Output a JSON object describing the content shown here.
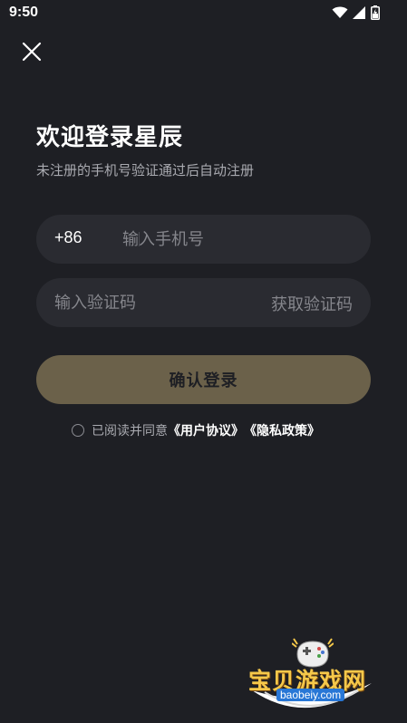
{
  "status_bar": {
    "time": "9:50"
  },
  "header": {
    "title": "欢迎登录星辰",
    "subtitle": "未注册的手机号验证通过后自动注册"
  },
  "phone_field": {
    "country_code": "+86",
    "placeholder": "输入手机号",
    "value": ""
  },
  "code_field": {
    "placeholder": "输入验证码",
    "value": "",
    "get_code_label": "获取验证码"
  },
  "login_button": {
    "label": "确认登录"
  },
  "agreement": {
    "checked": false,
    "prefix": "已阅读并同意",
    "user_agreement": "《用户协议》",
    "privacy_policy": "《隐私政策》"
  },
  "watermark": {
    "logo_text": "宝贝游戏网",
    "url": "baobeiy.com"
  },
  "colors": {
    "background": "#1e1f24",
    "field_background": "#2a2b31",
    "login_button": "#6b614a",
    "placeholder": "#85868c"
  }
}
